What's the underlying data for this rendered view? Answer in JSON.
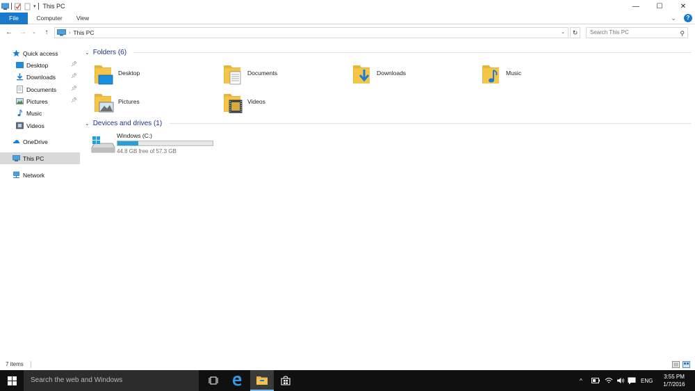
{
  "window": {
    "title": "This PC",
    "controls": {
      "minimize": "—",
      "maximize": "☐",
      "close": "✕"
    }
  },
  "ribbon": {
    "tabs": [
      {
        "label": "File"
      },
      {
        "label": "Computer"
      },
      {
        "label": "View"
      }
    ],
    "help": "?"
  },
  "address": {
    "path": "This PC",
    "search_placeholder": "Search This PC"
  },
  "sidebar": {
    "items": [
      {
        "label": "Quick access",
        "icon": "star-icon",
        "pinned": false
      },
      {
        "label": "Desktop",
        "icon": "desktop-icon",
        "pinned": true
      },
      {
        "label": "Downloads",
        "icon": "download-icon",
        "pinned": true
      },
      {
        "label": "Documents",
        "icon": "documents-icon",
        "pinned": true
      },
      {
        "label": "Pictures",
        "icon": "pictures-icon",
        "pinned": true
      },
      {
        "label": "Music",
        "icon": "music-icon",
        "pinned": false
      },
      {
        "label": "Videos",
        "icon": "videos-icon",
        "pinned": false
      },
      {
        "label": "OneDrive",
        "icon": "onedrive-icon",
        "pinned": false
      },
      {
        "label": "This PC",
        "icon": "this-pc-icon",
        "pinned": false,
        "selected": true
      },
      {
        "label": "Network",
        "icon": "network-icon",
        "pinned": false
      }
    ]
  },
  "content": {
    "folders_header": "Folders (6)",
    "folders": [
      {
        "label": "Desktop",
        "icon": "desktop-folder-icon"
      },
      {
        "label": "Documents",
        "icon": "documents-folder-icon"
      },
      {
        "label": "Downloads",
        "icon": "downloads-folder-icon"
      },
      {
        "label": "Music",
        "icon": "music-folder-icon"
      },
      {
        "label": "Pictures",
        "icon": "pictures-folder-icon"
      },
      {
        "label": "Videos",
        "icon": "videos-folder-icon"
      }
    ],
    "devices_header": "Devices and drives (1)",
    "drive": {
      "name": "Windows (C:)",
      "free_text": "44.8 GB free of 57.3 GB",
      "used_fraction": 0.218
    }
  },
  "status": {
    "items": "7 items"
  },
  "taskbar": {
    "search_placeholder": "Search the web and Windows",
    "language": "ENG",
    "time": "3:55 PM",
    "date": "1/7/2016"
  },
  "colors": {
    "accent": "#1979ca",
    "header_text": "#1e3287",
    "drive_fill": "#26a0da",
    "taskbar": "#101010",
    "folder_yellow": "#f5c54a"
  }
}
